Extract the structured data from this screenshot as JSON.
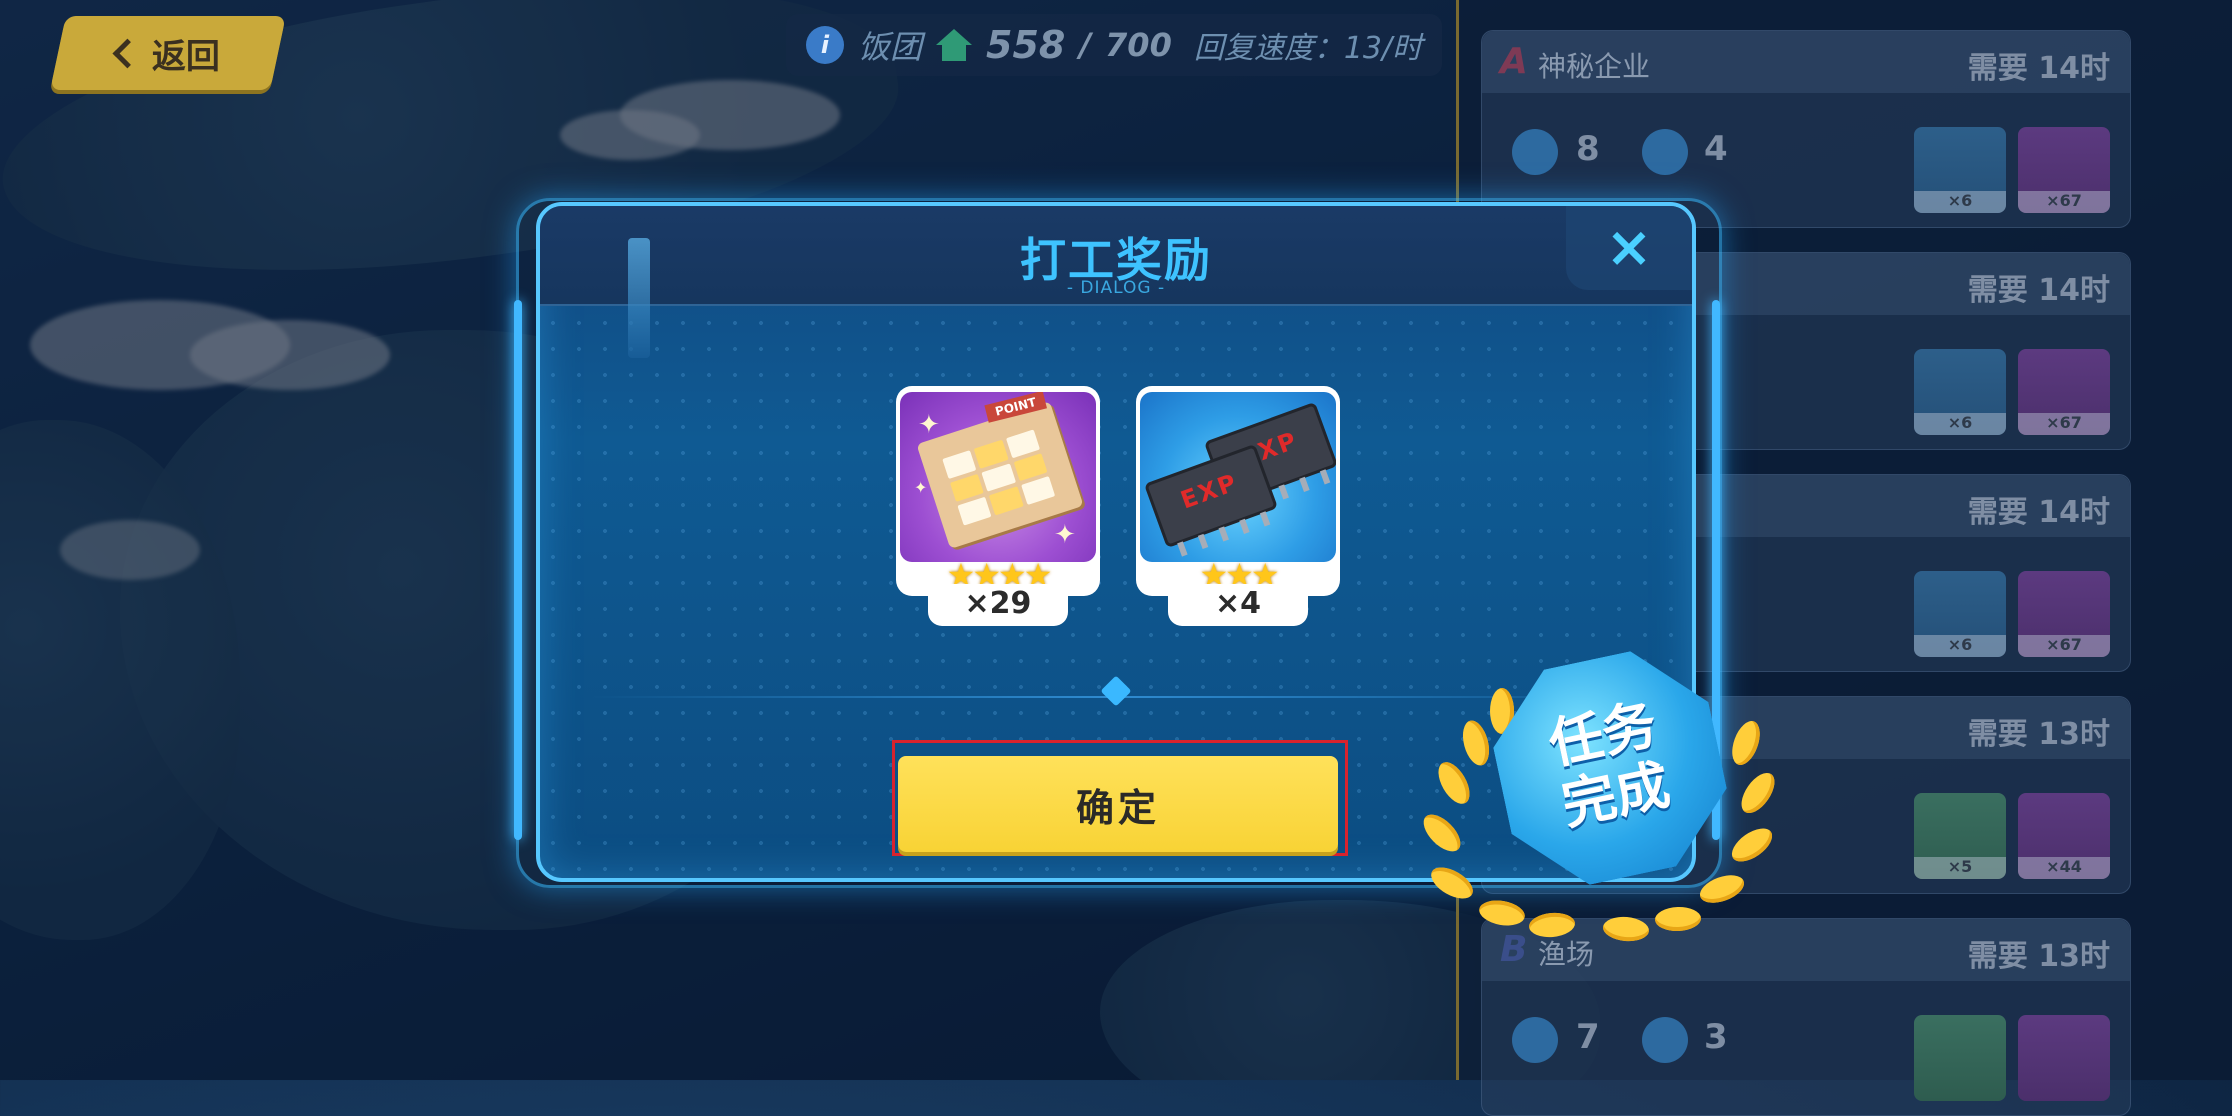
{
  "top_left": {
    "back_label": "返回"
  },
  "resource_bar": {
    "faction": "饭团",
    "current": "558",
    "max": "700",
    "separator": "/",
    "recovery": "回复速度：13/时"
  },
  "tasks": [
    {
      "rank": "A",
      "name": "神秘企业",
      "time": "需要 14时",
      "stat1": "8",
      "stat2": "4",
      "items": [
        {
          "count": "×6",
          "color": "blue"
        },
        {
          "count": "×67",
          "color": "purple"
        }
      ]
    },
    {
      "rank": "",
      "name": "",
      "time": "需要 14时",
      "stat1": "",
      "stat2": "",
      "items": [
        {
          "count": "×6",
          "color": "blue"
        },
        {
          "count": "×67",
          "color": "purple"
        }
      ]
    },
    {
      "rank": "",
      "name": "",
      "time": "需要 14时",
      "stat1": "",
      "stat2": "",
      "items": [
        {
          "count": "×6",
          "color": "blue"
        },
        {
          "count": "×67",
          "color": "purple"
        }
      ]
    },
    {
      "rank": "",
      "name": "",
      "time": "需要 13时",
      "stat1": "",
      "stat2": "",
      "items": [
        {
          "count": "×5",
          "color": "green"
        },
        {
          "count": "×44",
          "color": "purple"
        }
      ]
    },
    {
      "rank": "B",
      "name": "渔场",
      "time": "需要 13时",
      "stat1": "7",
      "stat2": "3",
      "items": [
        {
          "count": "",
          "color": "green"
        },
        {
          "count": "",
          "color": "purple"
        }
      ]
    }
  ],
  "dialog": {
    "title": "打工奖励",
    "subtitle": "- DIALOG -",
    "close_icon": "×",
    "rewards": [
      {
        "name": "point-card",
        "stars": "★★★★",
        "count": "×29",
        "card_tag": "POINT",
        "rarity_color": "#9d4fd2"
      },
      {
        "name": "exp-chip",
        "stars": "★★★",
        "count": "×4",
        "chip_text": "EXP",
        "rarity_color": "#2e9de6"
      }
    ],
    "confirm_label": "确定"
  },
  "stamp": {
    "line1": "任务",
    "line2": "完成"
  },
  "colors": {
    "accent": "#3ec3ff",
    "confirm": "#f8d335",
    "highlight_outline": "#d8232e"
  }
}
